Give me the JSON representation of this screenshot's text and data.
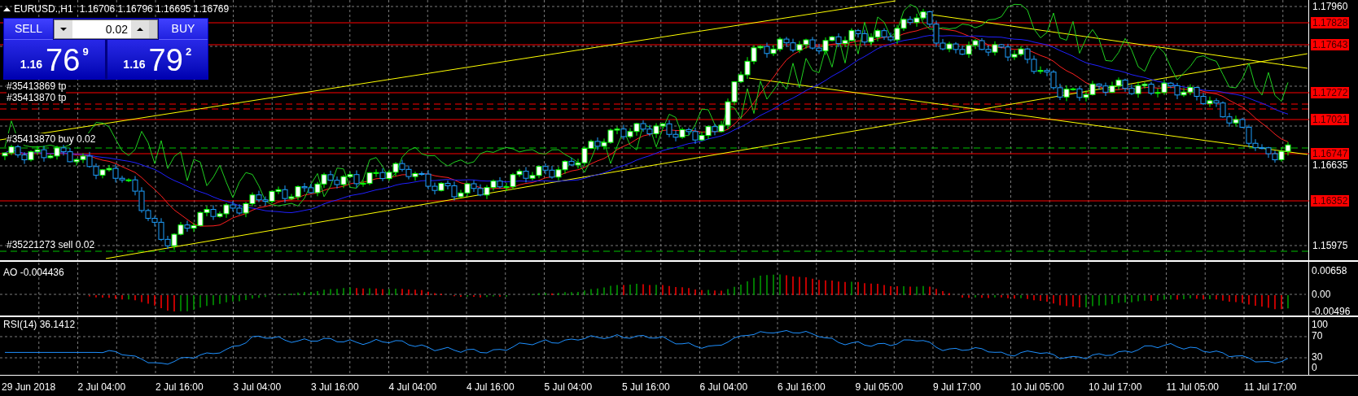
{
  "header": {
    "symbol": "EURUSD.,H1",
    "ohlc": "1.16706 1.16796 1.16695 1.16769"
  },
  "trade_panel": {
    "sell_label": "SELL",
    "buy_label": "BUY",
    "lot": "0.02",
    "sell_price": {
      "prefix": "1.16",
      "main": "76",
      "suffix": "9"
    },
    "buy_price": {
      "prefix": "1.16",
      "main": "79",
      "suffix": "2"
    }
  },
  "order_labels": [
    {
      "kind": "tp",
      "text": "#35413869 tp"
    },
    {
      "kind": "tp",
      "text": "#35413870 tp"
    },
    {
      "kind": "buy",
      "text": "#35413870 buy 0.02"
    },
    {
      "kind": "sell",
      "text": "#35221273 sell 0.02"
    }
  ],
  "price_axis": [
    {
      "kind": "tick",
      "label": "1.17960"
    },
    {
      "kind": "level",
      "label": "1.17828"
    },
    {
      "kind": "level",
      "label": "1.17643"
    },
    {
      "kind": "level",
      "label": "1.17272"
    },
    {
      "kind": "level",
      "label": "1.17021"
    },
    {
      "kind": "level",
      "label": "1.16747"
    },
    {
      "kind": "tick",
      "label": "1.16635"
    },
    {
      "kind": "level",
      "label": "1.16352"
    },
    {
      "kind": "tick",
      "label": "1.15975"
    }
  ],
  "ao": {
    "label": "AO -0.004436",
    "axis": [
      "0.00658",
      "0.00",
      "-0.00496"
    ]
  },
  "rsi": {
    "label": "RSI(14) 36.1412",
    "axis": [
      "100",
      "70",
      "30",
      "0"
    ]
  },
  "time_axis": [
    "29 Jun 2018",
    "2 Jul 04:00",
    "2 Jul 16:00",
    "3 Jul 04:00",
    "3 Jul 16:00",
    "4 Jul 04:00",
    "4 Jul 16:00",
    "5 Jul 04:00",
    "5 Jul 16:00",
    "6 Jul 04:00",
    "6 Jul 16:00",
    "9 Jul 05:00",
    "9 Jul 17:00",
    "10 Jul 05:00",
    "10 Jul 17:00",
    "11 Jul 05:00",
    "11 Jul 17:00"
  ]
}
